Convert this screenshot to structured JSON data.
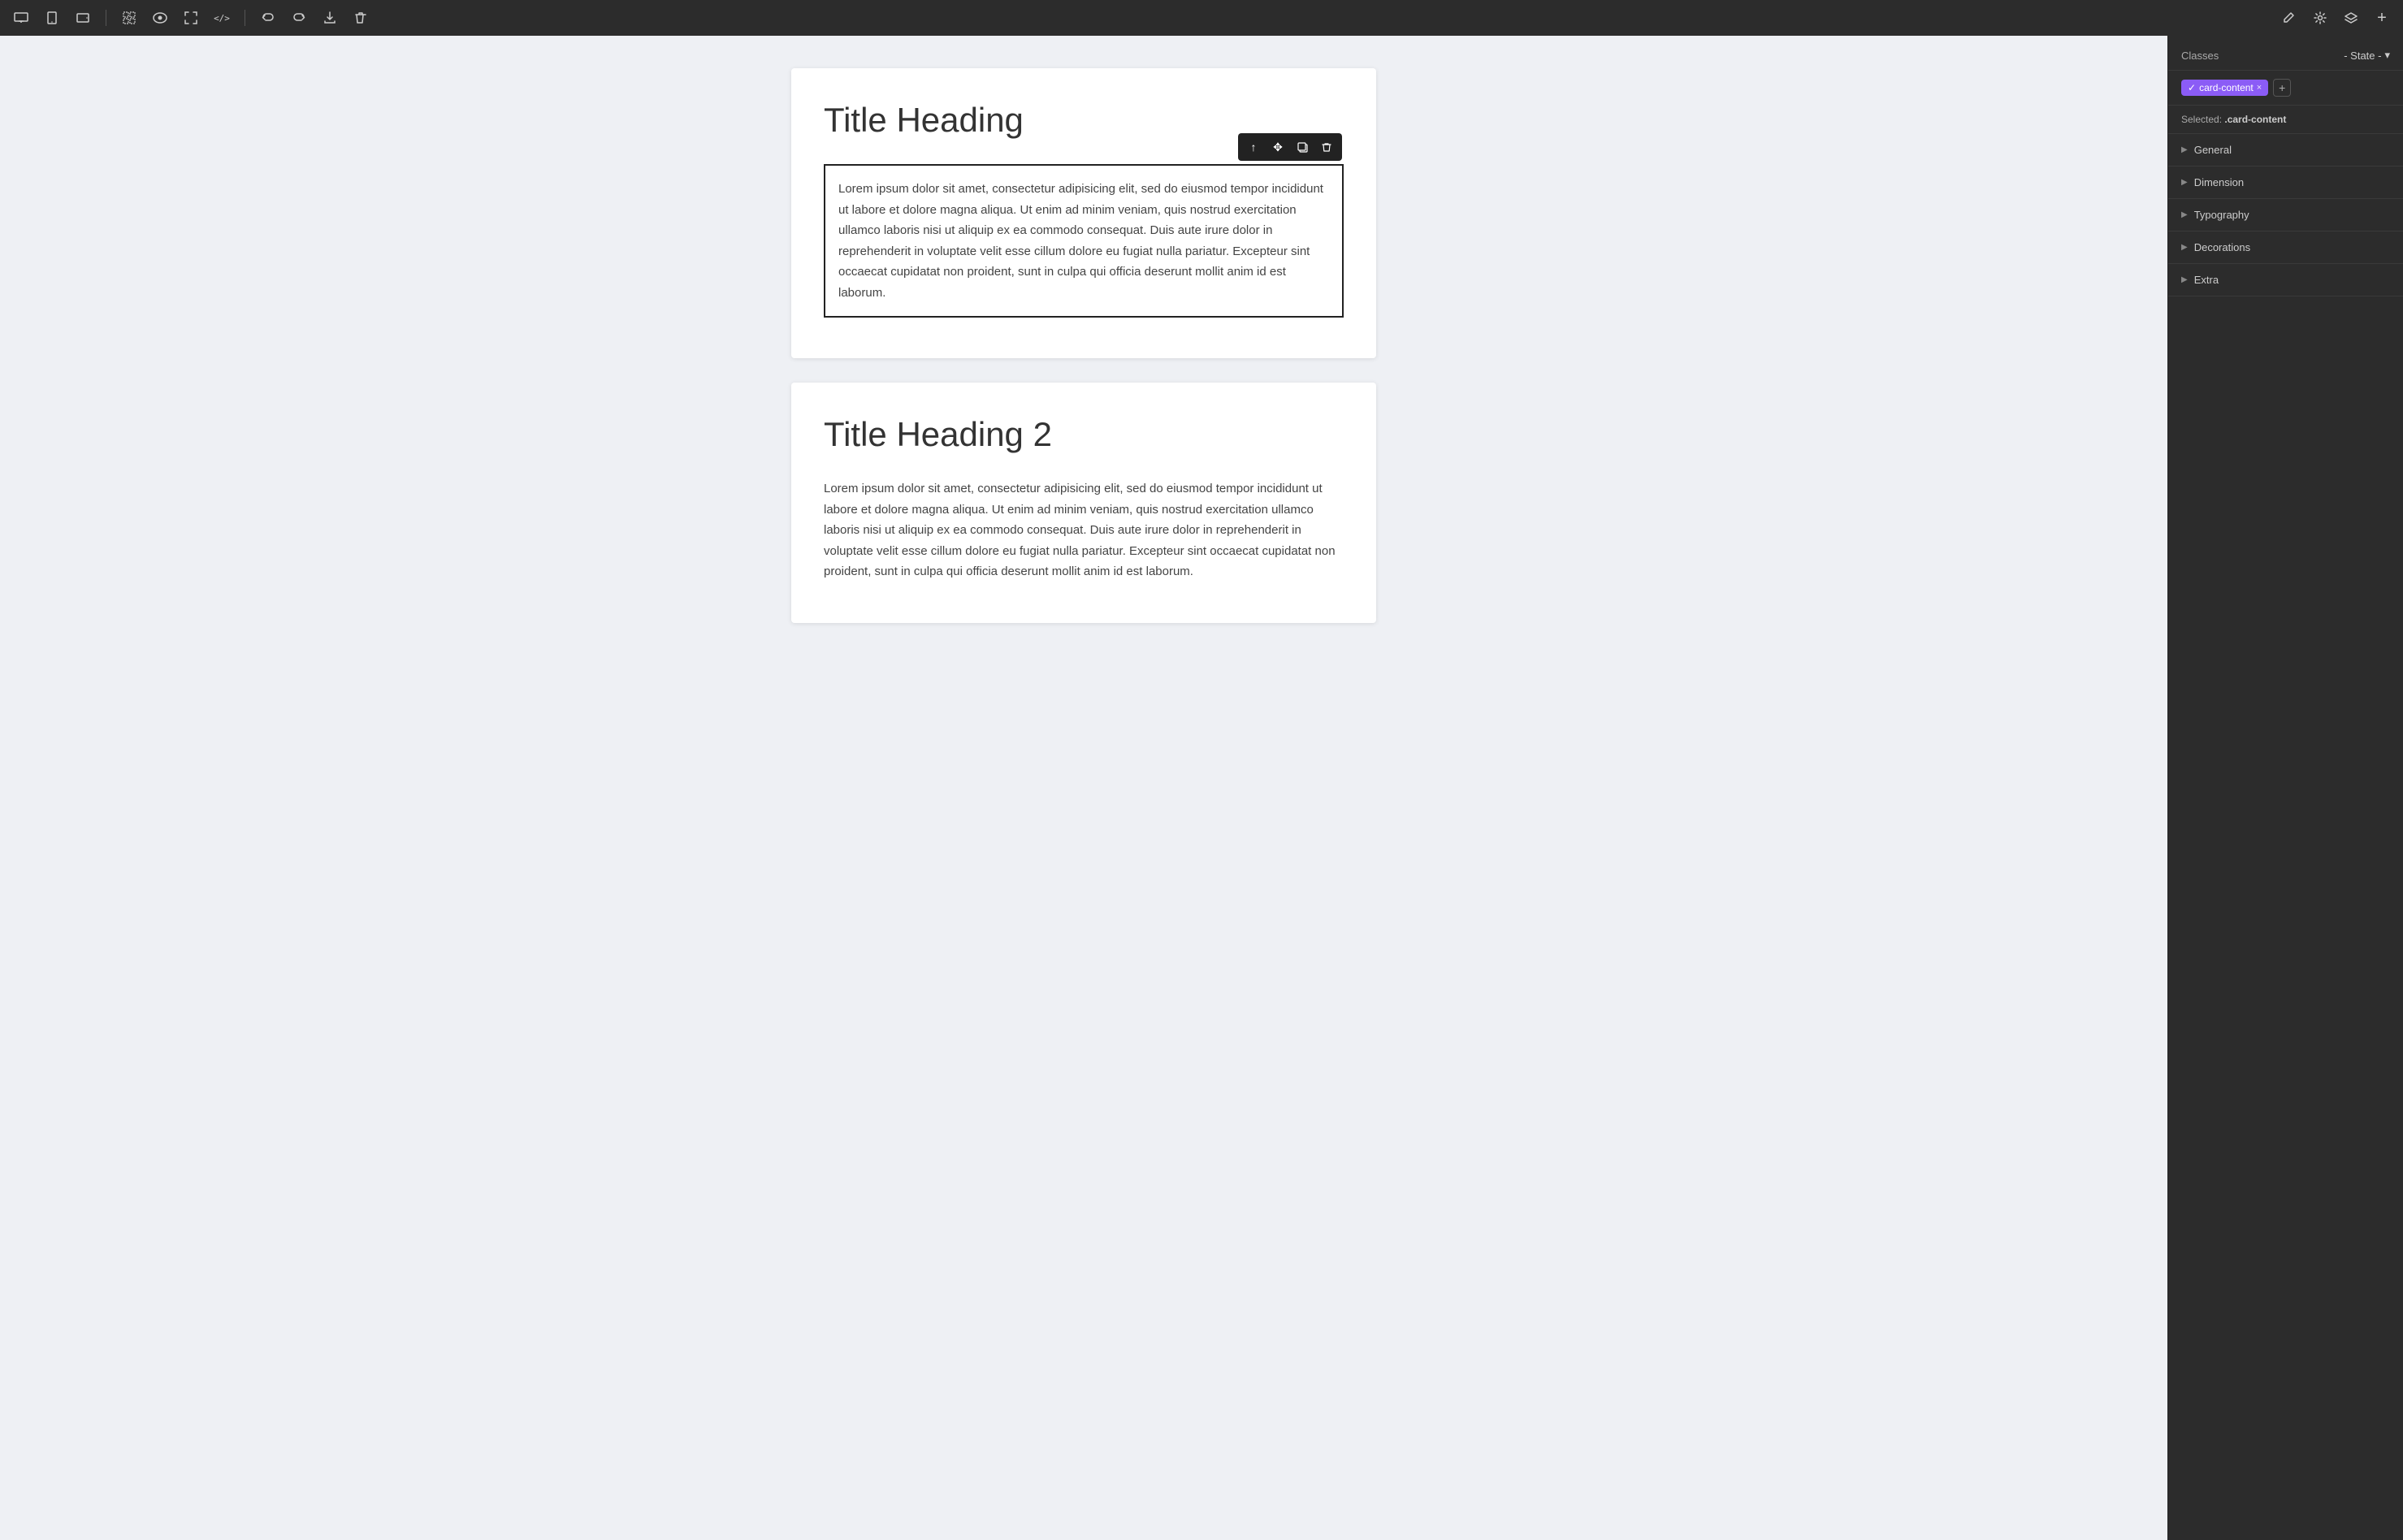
{
  "toolbar": {
    "device_icons": [
      "desktop-icon",
      "tablet-portrait-icon",
      "tablet-landscape-icon"
    ],
    "action_icons": [
      {
        "name": "select-icon",
        "symbol": "⬚"
      },
      {
        "name": "preview-icon",
        "symbol": "👁"
      },
      {
        "name": "responsive-icon",
        "symbol": "⊡"
      },
      {
        "name": "code-icon",
        "symbol": "</>"
      },
      {
        "name": "undo-icon",
        "symbol": "↩"
      },
      {
        "name": "redo-icon",
        "symbol": "↪"
      },
      {
        "name": "download-icon",
        "symbol": "⬇"
      },
      {
        "name": "delete-icon",
        "symbol": "🗑"
      }
    ],
    "right_icons": [
      {
        "name": "pen-icon",
        "symbol": "✏"
      },
      {
        "name": "settings-icon",
        "symbol": "⚙"
      },
      {
        "name": "layers-icon",
        "symbol": "⧉"
      },
      {
        "name": "add-icon",
        "symbol": "+"
      }
    ]
  },
  "canvas": {
    "cards": [
      {
        "id": "card-1",
        "title": "Title Heading",
        "content": "Lorem ipsum dolor sit amet, consectetur adipisicing elit, sed do eiusmod tempor incididunt ut labore et dolore magna aliqua. Ut enim ad minim veniam, quis nostrud exercitation ullamco laboris nisi ut aliquip ex ea commodo consequat. Duis aute irure dolor in reprehenderit in voluptate velit esse cillum dolore eu fugiat nulla pariatur. Excepteur sint occaecat cupidatat non proident, sunt in culpa qui officia deserunt mollit anim id est laborum.",
        "selected": true
      },
      {
        "id": "card-2",
        "title": "Title Heading 2",
        "content": "Lorem ipsum dolor sit amet, consectetur adipisicing elit, sed do eiusmod tempor incididunt ut labore et dolore magna aliqua. Ut enim ad minim veniam, quis nostrud exercitation ullamco laboris nisi ut aliquip ex ea commodo consequat. Duis aute irure dolor in reprehenderit in voluptate velit esse cillum dolore eu fugiat nulla pariatur. Excepteur sint occaecat cupidatat non proident, sunt in culpa qui officia deserunt mollit anim id est laborum.",
        "selected": false
      }
    ],
    "float_toolbar": {
      "buttons": [
        {
          "name": "move-up-button",
          "symbol": "↑"
        },
        {
          "name": "move-button",
          "symbol": "✥"
        },
        {
          "name": "duplicate-button",
          "symbol": "⧉"
        },
        {
          "name": "delete-float-button",
          "symbol": "🗑"
        }
      ]
    }
  },
  "right_panel": {
    "header": {
      "classes_label": "Classes",
      "state_label": "- State -",
      "state_arrow": "▾"
    },
    "class_tag": {
      "name": "card-content",
      "checkmark": "✓"
    },
    "selected_label": "Selected: ",
    "selected_value": ".card-content",
    "sections": [
      {
        "id": "general",
        "label": "General"
      },
      {
        "id": "dimension",
        "label": "Dimension"
      },
      {
        "id": "typography",
        "label": "Typography"
      },
      {
        "id": "decorations",
        "label": "Decorations"
      },
      {
        "id": "extra",
        "label": "Extra"
      }
    ]
  }
}
